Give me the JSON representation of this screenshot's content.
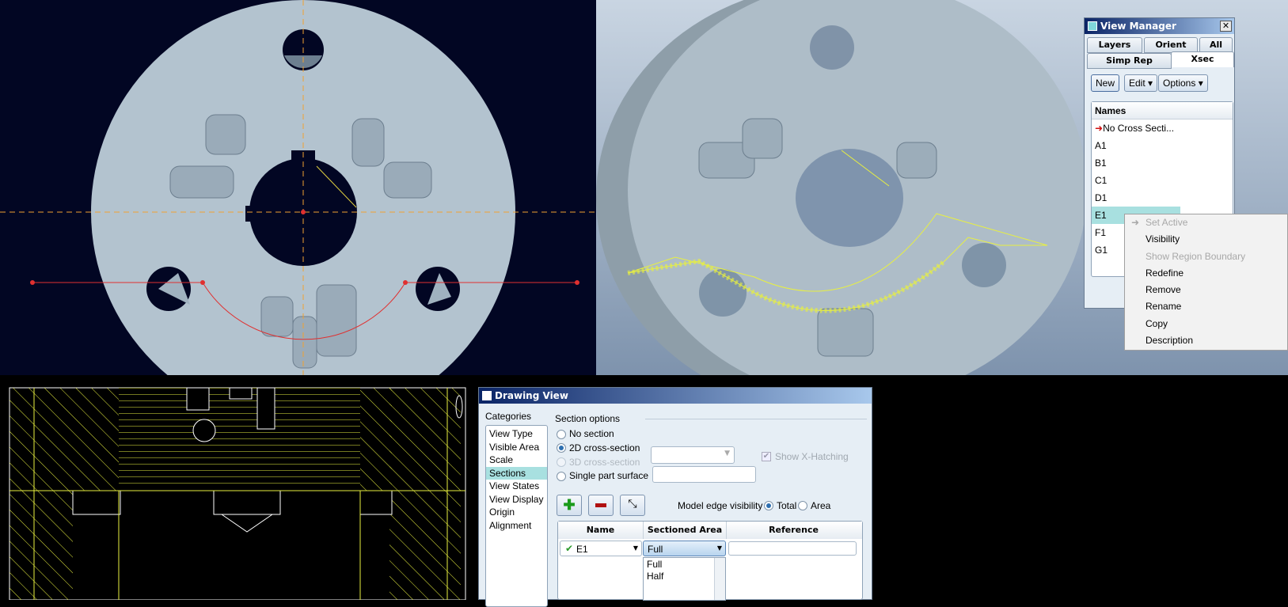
{
  "view_manager": {
    "title": "View Manager",
    "tabs": [
      "Layers",
      "Orient",
      "All",
      "Simp Rep",
      "Xsec"
    ],
    "active_tab": "Xsec",
    "buttons": {
      "new": "New",
      "edit": "Edit",
      "options": "Options"
    },
    "column_header": "Names",
    "items": [
      "No Cross Secti...",
      "A1",
      "B1",
      "C1",
      "D1",
      "E1",
      "F1",
      "G1"
    ],
    "selected": "E1"
  },
  "context_menu": {
    "items": [
      {
        "label": "Set Active",
        "disabled": true
      },
      {
        "label": "Visibility",
        "disabled": false
      },
      {
        "label": "Show Region Boundary",
        "disabled": true
      },
      {
        "label": "Redefine",
        "disabled": false
      },
      {
        "label": "Remove",
        "disabled": false
      },
      {
        "label": "Rename",
        "disabled": false
      },
      {
        "label": "Copy",
        "disabled": false
      },
      {
        "label": "Description",
        "disabled": false
      }
    ]
  },
  "drawing_view": {
    "title": "Drawing View",
    "categories_label": "Categories",
    "categories": [
      "View Type",
      "Visible Area",
      "Scale",
      "Sections",
      "View States",
      "View Display",
      "Origin",
      "Alignment"
    ],
    "selected_category": "Sections",
    "section_options_label": "Section options",
    "options": {
      "no_section": "No section",
      "cs2d": "2D cross-section",
      "cs3d": "3D cross-section",
      "single": "Single part surface"
    },
    "selected_option": "2D cross-section",
    "show_hatching": "Show X-Hatching",
    "edge_visibility_label": "Model edge visibility",
    "edge_total": "Total",
    "edge_area": "Area",
    "edge_selected": "Total",
    "table": {
      "headers": [
        "Name",
        "Sectioned Area",
        "Reference"
      ],
      "rows": [
        {
          "name": "E1",
          "area": "Full",
          "reference": ""
        }
      ]
    },
    "dropdown_options": [
      "Full",
      "Half"
    ]
  },
  "colors": {
    "viewport_bg": "#020623",
    "part": "#b3c3cf",
    "hatch": "#e8f040",
    "section_line": "#e03030",
    "axis": "#f0a030",
    "selection": "#a8e0e0"
  }
}
